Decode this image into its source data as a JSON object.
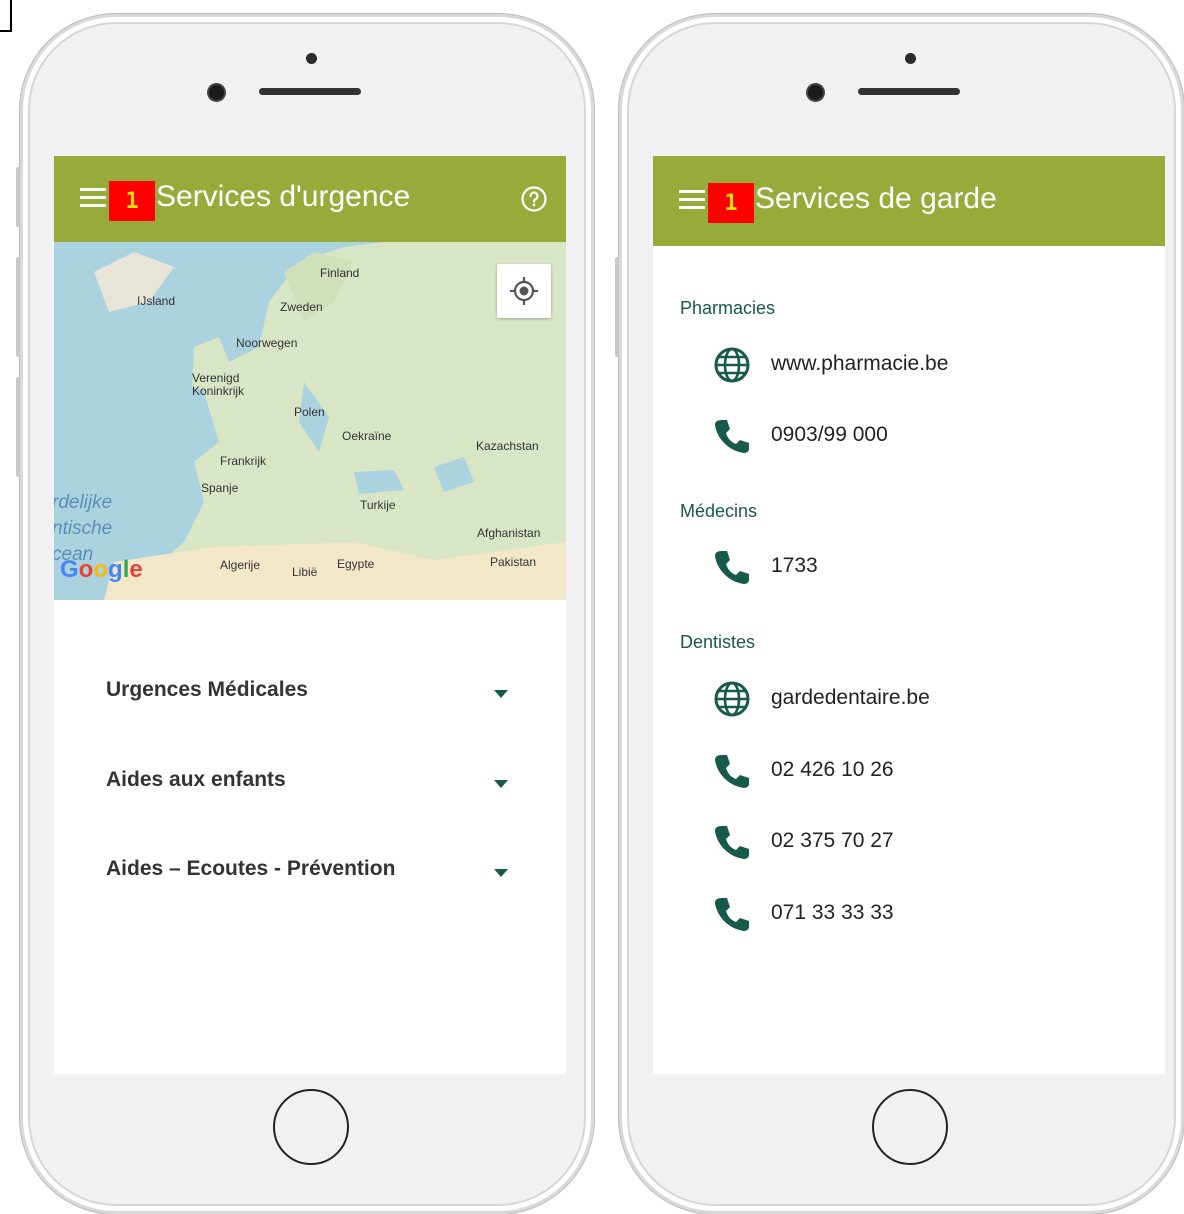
{
  "colors": {
    "appbar": "#97ab3b",
    "badge_bg": "#ff0000",
    "badge_fg": "#ffde00",
    "accent": "#17594a"
  },
  "left_screen": {
    "badge": "1",
    "title": "Services d'urgence",
    "help_icon": "help-circle-icon",
    "map": {
      "labels": [
        "Finland",
        "IJsland",
        "Zweden",
        "Noorwegen",
        "Verenigd",
        "Koninkrijk",
        "Polen",
        "Oekraïne",
        "Kazachstan",
        "Frankrijk",
        "Spanje",
        "Turkije",
        "Afghanistan",
        "Pakistan",
        "Algerije",
        "Libië",
        "Egypte"
      ],
      "ocean": [
        "rdelijke",
        "ntische",
        "cean"
      ],
      "logo": "Google"
    },
    "accordion": [
      {
        "label": "Urgences Médicales"
      },
      {
        "label": "Aides aux enfants"
      },
      {
        "label": "Aides – Ecoutes - Prévention"
      }
    ]
  },
  "right_screen": {
    "badge": "1",
    "title": "Services de garde",
    "sections": [
      {
        "title": "Pharmacies",
        "items": [
          {
            "icon": "globe-icon",
            "text": "www.pharmacie.be"
          },
          {
            "icon": "phone-icon",
            "text": "0903/99 000"
          }
        ]
      },
      {
        "title": "Médecins",
        "items": [
          {
            "icon": "phone-icon",
            "text": "1733"
          }
        ]
      },
      {
        "title": "Dentistes",
        "items": [
          {
            "icon": "globe-icon",
            "text": "gardedentaire.be"
          },
          {
            "icon": "phone-icon",
            "text": "02 426 10 26"
          },
          {
            "icon": "phone-icon",
            "text": "02 375 70 27"
          },
          {
            "icon": "phone-icon",
            "text": "071 33 33 33"
          }
        ]
      }
    ]
  }
}
